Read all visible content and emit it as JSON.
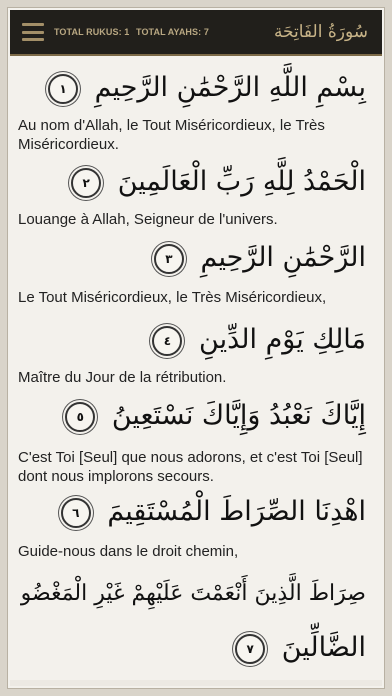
{
  "header": {
    "menu_icon": "hamburger-menu-icon",
    "total_rukus": "TOTAL RUKUS: 1",
    "total_ayahs": "TOTAL AYAHS: 7",
    "surah_title": "سُورَةُ الفَاتِحَة"
  },
  "verses": [
    {
      "number": "١",
      "arabic": "بِسْمِ اللَّهِ الرَّحْمَٰنِ الرَّحِيمِ",
      "translation": "Au nom d'Allah, le Tout Miséricordieux, le Très Miséricordieux."
    },
    {
      "number": "٢",
      "arabic": "الْحَمْدُ لِلَّهِ رَبِّ الْعَالَمِينَ",
      "translation": "Louange à Allah, Seigneur de l'univers."
    },
    {
      "number": "٣",
      "arabic": "الرَّحْمَٰنِ الرَّحِيمِ",
      "translation": "Le Tout Miséricordieux, le Très Miséricordieux,"
    },
    {
      "number": "٤",
      "arabic": "مَالِكِ يَوْمِ الدِّينِ",
      "translation": "Maître du Jour de la rétribution."
    },
    {
      "number": "٥",
      "arabic": "إِيَّاكَ نَعْبُدُ وَإِيَّاكَ نَسْتَعِينُ",
      "translation": "C'est Toi [Seul] que nous adorons, et c'est Toi [Seul] dont nous implorons secours."
    },
    {
      "number": "٦",
      "arabic": "اهْدِنَا الصِّرَاطَ الْمُسْتَقِيمَ",
      "translation": "Guide-nous dans le droit chemin,"
    },
    {
      "number": "٧",
      "arabic_line1": "صِرَاطَ الَّذِينَ أَنْعَمْتَ عَلَيْهِمْ غَيْرِ الْمَغْضُوبِ عَلَيْهِمْ وَلَا",
      "arabic_line2": "الضَّالِّينَ"
    }
  ]
}
